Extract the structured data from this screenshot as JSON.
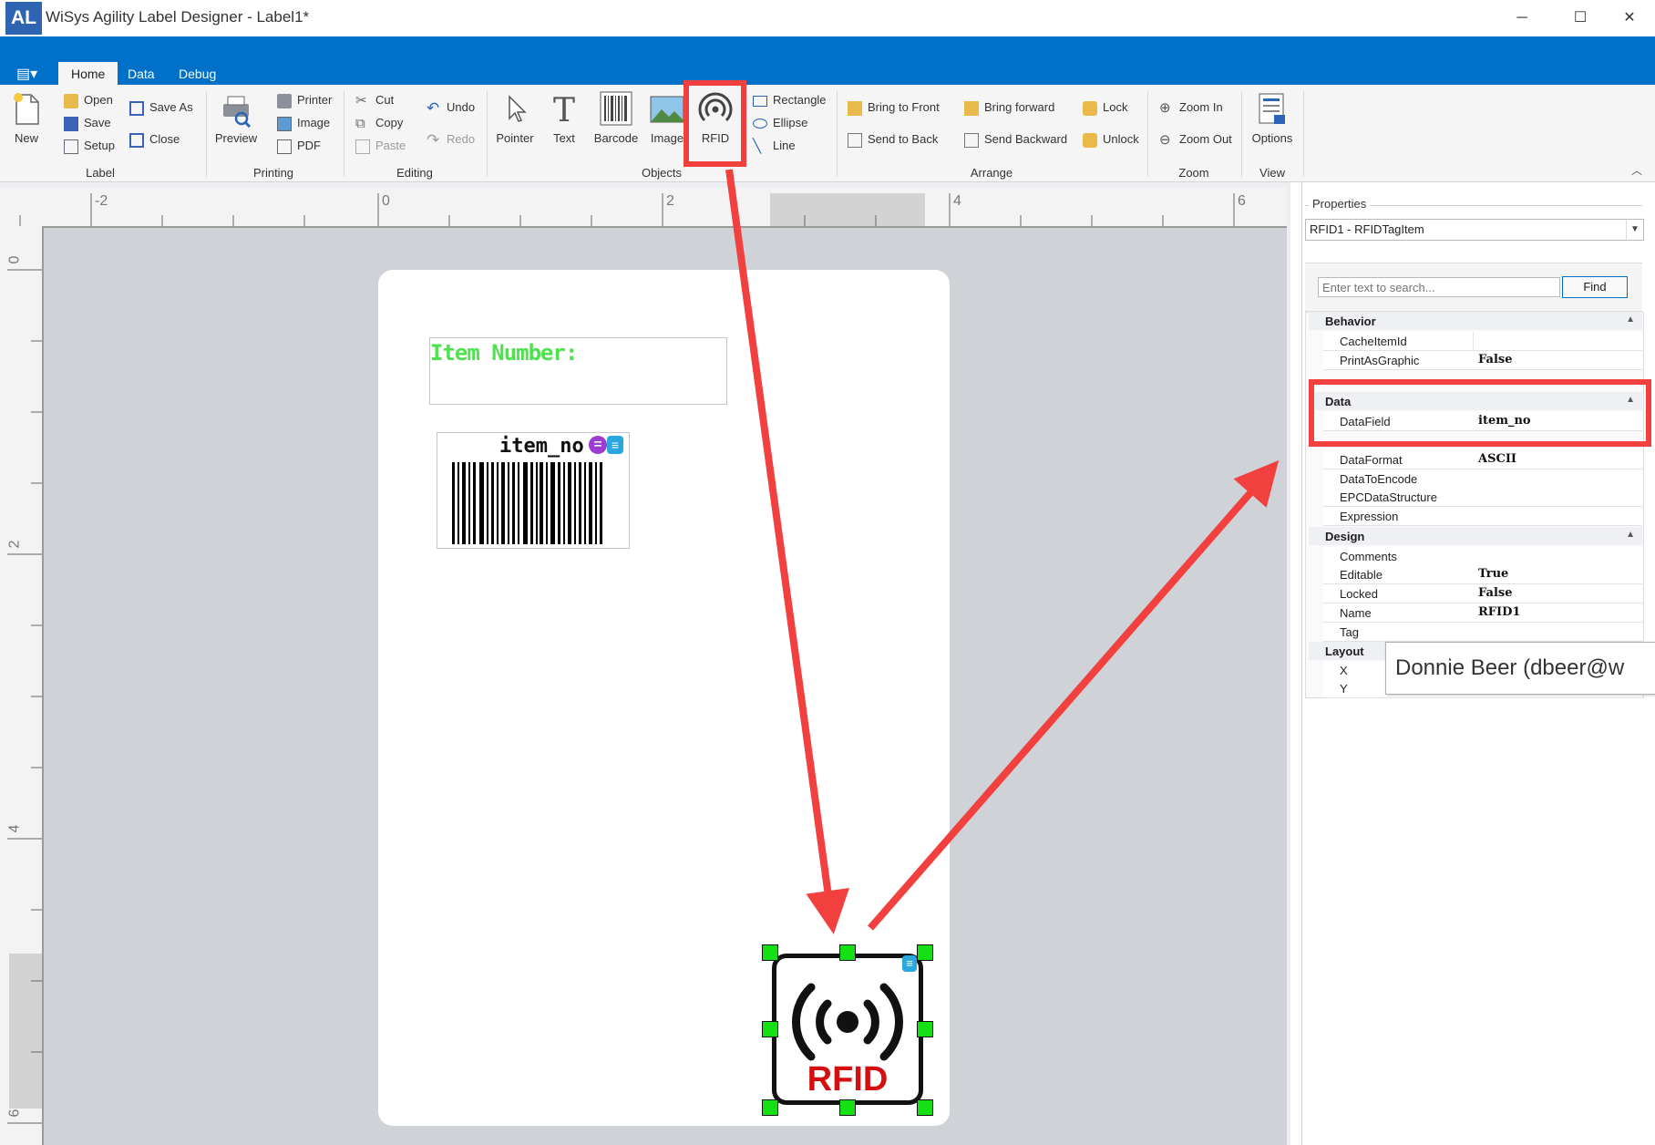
{
  "window": {
    "logo_text": "AL",
    "title": "WiSys Agility Label Designer - Label1*",
    "minimize": "─",
    "maximize": "☐",
    "close": "✕"
  },
  "tabs": [
    "Home",
    "Data",
    "Debug"
  ],
  "ribbon": {
    "label_group": {
      "label": "Label",
      "new": "New",
      "open": "Open",
      "save": "Save",
      "setup": "Setup",
      "save_as": "Save As",
      "close": "Close"
    },
    "printing_group": {
      "label": "Printing",
      "preview": "Preview",
      "printer": "Printer",
      "image": "Image",
      "pdf": "PDF"
    },
    "editing_group": {
      "label": "Editing",
      "cut": "Cut",
      "copy": "Copy",
      "paste": "Paste",
      "undo": "Undo",
      "redo": "Redo"
    },
    "objects_group": {
      "label": "Objects",
      "pointer": "Pointer",
      "text": "Text",
      "barcode": "Barcode",
      "image": "Image",
      "rfid": "RFID",
      "rectangle": "Rectangle",
      "ellipse": "Ellipse",
      "line": "Line"
    },
    "arrange_group": {
      "label": "Arrange",
      "bring_to_front": "Bring to Front",
      "send_to_back": "Send to Back",
      "bring_forward": "Bring forward",
      "send_backward": "Send Backward",
      "lock": "Lock",
      "unlock": "Unlock"
    },
    "zoom_group": {
      "label": "Zoom",
      "zoom_in": "Zoom In",
      "zoom_out": "Zoom Out"
    },
    "view_group": {
      "label": "View",
      "options": "Options"
    }
  },
  "rulers": {
    "horizontal": [
      "-2",
      "0",
      "2",
      "4",
      "6"
    ],
    "vertical": [
      "0",
      "2",
      "4",
      "6"
    ]
  },
  "label_content": {
    "item_number_text": "Item Number:",
    "barcode_field": "item_no",
    "rfid_text": "RFID"
  },
  "properties": {
    "header": "Properties",
    "selected_object": "RFID1 - RFIDTagItem",
    "search_placeholder": "Enter text to search...",
    "find_button": "Find",
    "categories": [
      {
        "name": "Behavior",
        "rows": [
          {
            "name": "CacheItemId",
            "value": ""
          },
          {
            "name": "PrintAsGraphic",
            "value": "False"
          }
        ]
      },
      {
        "name": "Data",
        "rows": [
          {
            "name": "DataField",
            "value": "item_no"
          },
          {
            "name": "DataFormat",
            "value": "ASCII"
          },
          {
            "name": "DataToEncode",
            "value": ""
          },
          {
            "name": "EPCDataStructure",
            "value": ""
          },
          {
            "name": "Expression",
            "value": ""
          }
        ]
      },
      {
        "name": "Design",
        "rows": [
          {
            "name": "Comments",
            "value": ""
          },
          {
            "name": "Editable",
            "value": "True"
          },
          {
            "name": "Locked",
            "value": "False"
          },
          {
            "name": "Name",
            "value": "RFID1"
          },
          {
            "name": "Tag",
            "value": ""
          }
        ]
      },
      {
        "name": "Layout",
        "rows": [
          {
            "name": "X",
            "value": ""
          },
          {
            "name": "Y",
            "value": ""
          }
        ]
      }
    ]
  },
  "tooltip": {
    "text": "Donnie Beer (dbeer@w"
  },
  "colors": {
    "accent": "#0070c8",
    "highlight": "#f2403f",
    "item_number": "#4ee34e",
    "rfid_red": "#d50f0f",
    "handle": "#14e014"
  }
}
